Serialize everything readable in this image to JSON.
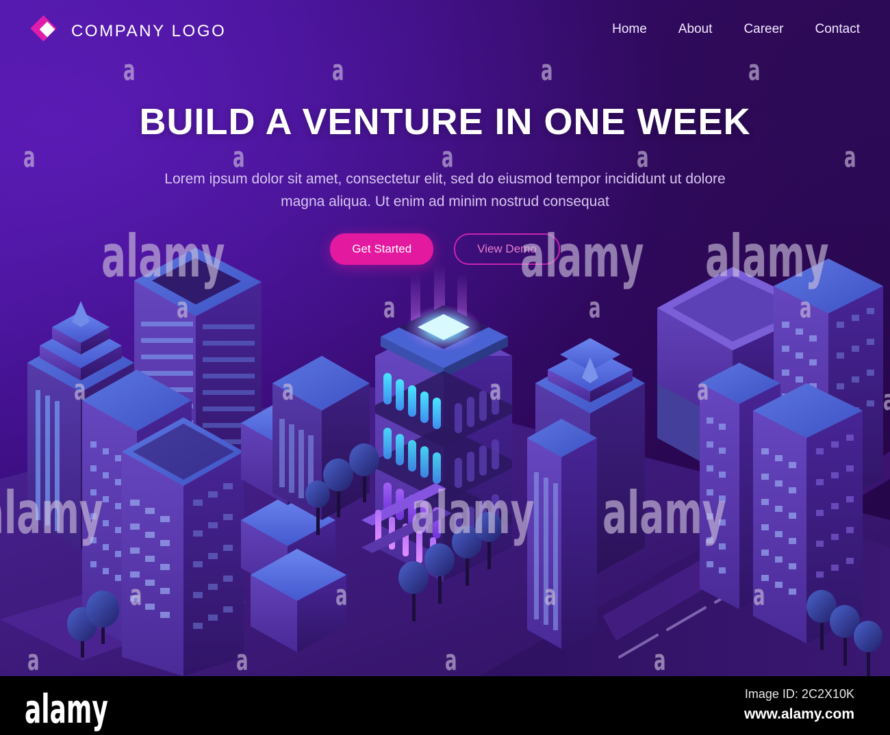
{
  "header": {
    "logo": {
      "text": "COMPANY LOGO",
      "icon": "diamond-logo-icon",
      "color": "#e01cac"
    },
    "nav": [
      {
        "label": "Home"
      },
      {
        "label": "About"
      },
      {
        "label": "Career"
      },
      {
        "label": "Contact"
      }
    ]
  },
  "hero": {
    "title": "BUILD A VENTURE IN ONE WEEK",
    "subtitle": "Lorem ipsum dolor sit amet, consectetur elit, sed do eiusmod tempor incididunt ut dolore magna aliqua. Ut enim ad minim nostrud consequat",
    "primary_button": "Get Started",
    "secondary_button": "View Demo",
    "primary_color": "#e3199f",
    "secondary_border_color": "#c724b0"
  },
  "illustration": {
    "description": "isometric neon night city with skyscrapers, glowing central tower, trees and road",
    "background_start": "#4d17a8",
    "background_end": "#240547",
    "accent_glow": "#5ee8f7"
  },
  "watermark": {
    "letter": "a",
    "word": "alamy",
    "color": "#cfc2de"
  },
  "footer": {
    "brand": "alamy",
    "image_id": "Image ID: 2C2X10K",
    "url": "www.alamy.com"
  }
}
